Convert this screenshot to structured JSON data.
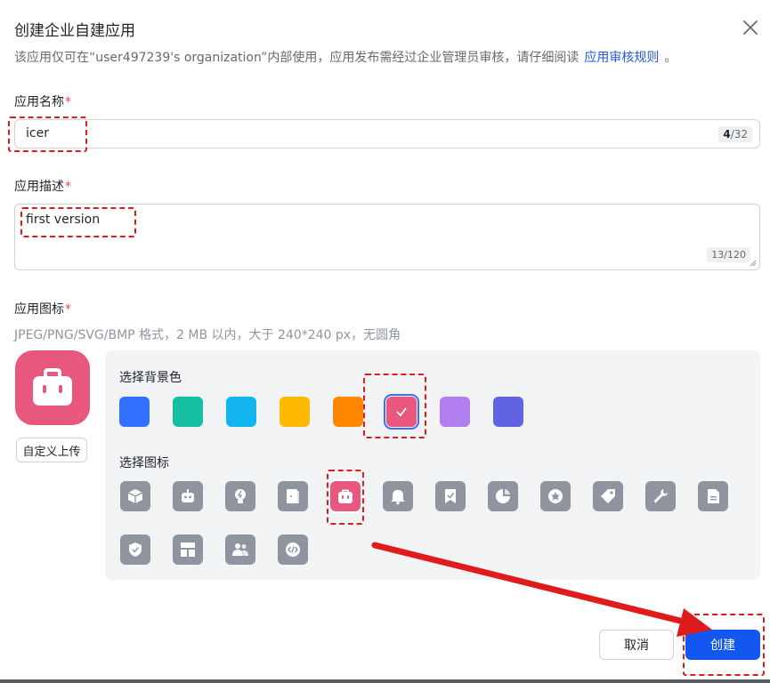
{
  "dialog": {
    "title": "创建企业自建应用",
    "subtitle_prefix": "该应用仅可在“user497239's organization”内部使用，应用发布需经过企业管理员审核，请仔细阅读",
    "subtitle_link": "应用审核规则",
    "subtitle_suffix": "。"
  },
  "name_field": {
    "label": "应用名称",
    "required_mark": "*",
    "value": "icer",
    "count_current": "4",
    "count_max": "/32"
  },
  "desc_field": {
    "label": "应用描述",
    "required_mark": "*",
    "value": "first version",
    "count_current": "13",
    "count_max": "/120"
  },
  "icon_field": {
    "label": "应用图标",
    "required_mark": "*",
    "hint": "JPEG/PNG/SVG/BMP 格式，2 MB 以内，大于 240*240 px，无圆角",
    "upload_label": "自定义上传"
  },
  "panel": {
    "bg_label": "选择背景色",
    "icon_label": "选择图标",
    "background_colors": [
      "#3370ff",
      "#14c0a0",
      "#12b5f0",
      "#ffba00",
      "#ff8800",
      "#e8577e",
      "#b17ef0",
      "#6263e3"
    ],
    "selected_color_index": 5,
    "icons": [
      "cube-icon",
      "robot-icon",
      "bulb-icon",
      "door-icon",
      "briefcase-icon",
      "bell-icon",
      "bookmark-check-icon",
      "pie-chart-icon",
      "star-badge-icon",
      "tag-icon",
      "wrench-icon",
      "document-icon",
      "shield-check-icon",
      "layout-icon",
      "users-icon",
      "code-icon"
    ],
    "selected_icon_index": 4
  },
  "footer": {
    "cancel_label": "取消",
    "create_label": "创建"
  },
  "colors": {
    "primary": "#1456f0",
    "selected_icon_bg": "#e8577e",
    "annotation_red": "#e01b1b"
  }
}
